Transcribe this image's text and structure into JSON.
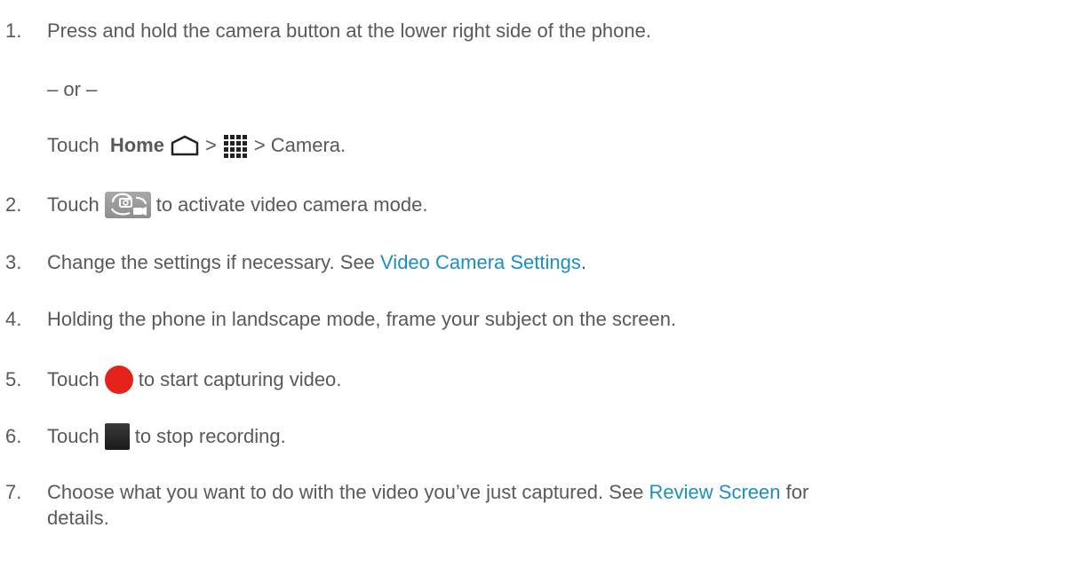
{
  "steps": [
    {
      "num": "1.",
      "text": "Press and hold the camera button at the lower right side of the phone."
    },
    {
      "num": "2.",
      "pre": "Touch",
      "post": "to activate video camera mode."
    },
    {
      "num": "3.",
      "pre": "Change the settings if necessary. See ",
      "link": "Video Camera Settings",
      "post": "."
    },
    {
      "num": "4.",
      "text": "Holding the phone in landscape mode, frame your subject on the screen."
    },
    {
      "num": "5.",
      "pre": "Touch",
      "post": "to start capturing video."
    },
    {
      "num": "6.",
      "pre": "Touch",
      "post": "to stop recording."
    },
    {
      "num": "7.",
      "pre": "Choose what you want to do with the video you’ve just captured. See ",
      "link": "Review Screen",
      "post": " for",
      "cont": "details."
    }
  ],
  "alt": {
    "or": "– or –",
    "touch": "Touch ",
    "home_bold": "Home",
    "sep1": ">",
    "sep2": "> Camera."
  },
  "colors": {
    "text": "#595959",
    "link": "#1b8fc2",
    "record": "#e3231c",
    "stop": "#222222",
    "mode_icon_bg": "#9a9a9a"
  },
  "icons": {
    "home": "home-icon",
    "apps": "apps-grid-icon",
    "mode": "camera-video-switch-icon",
    "record": "record-icon",
    "stop": "stop-icon"
  }
}
